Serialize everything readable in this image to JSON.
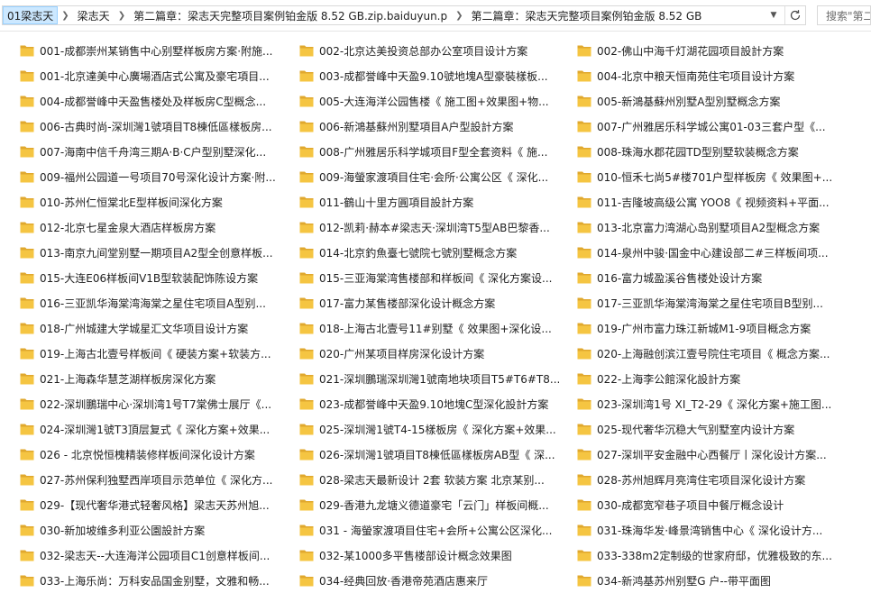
{
  "breadcrumbs": [
    "01梁志天",
    "梁志天",
    "第二篇章：梁志天完整项目案例铂金版  8.52 GB.zip.baiduyun.p",
    "第二篇章：梁志天完整项目案例铂金版  8.52 GB"
  ],
  "search": {
    "placeholder": "搜索\"第二"
  },
  "icons": {
    "folder": "folder-icon",
    "refresh": "refresh-icon",
    "dropdown": "chevron-down-icon",
    "separator": "chevron-right-icon"
  },
  "colors": {
    "folder": "#f5c542",
    "folder_dark": "#e0a82e",
    "selection": "#cce8ff"
  },
  "items": [
    "001-成都崇州某销售中心别墅样板房方案·附施...",
    "002-北京达美投资总部办公室项目设计方案",
    "002-佛山中海千灯湖花园项目設計方案",
    "001-北京達美中心廣場酒店式公寓及豪宅項目...",
    "003-成都誉峰中天盈9.10號地塊A型豪裝樣板...",
    "004-北京中粮天恒南苑住宅项目设计方案",
    "004-成都誉峰中天盈售楼处及样板房C型概念...",
    "005-大连海洋公园售楼《 施工图+效果图+物...",
    "005-新鴻基蘇州別墅A型別墅概念方案",
    "006-古典时尚-深圳灣1號項目T8棟低區樣板房...",
    "006-新鴻基蘇州別墅項目A户型設計方案",
    "007-广州雅居乐科学城公寓01-03三套户型《...",
    "007-海南中信千舟湾三期A·B·C户型别墅深化...",
    "008-广州雅居乐科学城项目F型全套资料《 施...",
    "008-珠海水郡花园TD型别墅软装概念方案",
    "009-福州公园道一号项目70号深化设计方案·附...",
    "009-海螢家渡項目住宅·会所·公寓公区《 深化...",
    "010-恒禾七尚5#楼701户型样板房《 效果图+...",
    "010-苏州仁恒棠北E型样板间深化方案",
    "011-鶴山十里方圓項目設計方案",
    "011-吉隆坡高级公寓 YOO8《 视频资料+平面...",
    "012-北京七星金泉大酒店样板房方案",
    "012-凯莉·赫本#梁志天·深圳湾T5型AB巴黎香...",
    "013-北京富力湾湖心岛别墅项目A2型概念方案",
    "013-南京九间堂别墅一期项目A2型全创意样板...",
    "014-北京釣魚臺七號院七號別墅概念方案",
    "014-泉州中骏·国金中心建设部二#三样板间项...",
    "015-大连E06样板间V1B型软装配饰陈设方案",
    "015-三亚海棠湾售楼部和样板间《 深化方案设...",
    "016-富力城盈溪谷售楼处设计方案",
    "016-三亚凯华海棠湾海棠之星住宅项目A型别...",
    "017-富力某售楼部深化设计概念方案",
    "017-三亚凯华海棠湾海棠之星住宅项目B型别...",
    "018-广州城建大学城星汇文华项目设计方案",
    "018-上海古北壹号11#别墅《 效果图+深化设...",
    "019-广州市富力珠江新城M1-9项目概念方案",
    "019-上海古北壹号样板间《 硬装方案+软装方...",
    "020-广州某项目样房深化设计方案",
    "020-上海融创滨江壹号院住宅项目《 概念方案...",
    "021-上海森华慧芝湖样板房深化方案",
    "021-深圳鵬瑞深圳灣1號南地块项目T5#T6#T8...",
    "022-上海李公館深化設計方案",
    "022-深圳鵬瑞中心·深圳湾1号T7棠佛士展厅《...",
    "023-成都誉峰中天盈9.10地塊C型深化設計方案",
    "023-深圳湾1号 XI_T2-29《 深化方案+施工图...",
    "024-深圳灣1號T3頂层复式《 深化方案+效果...",
    "025-深圳灣1號T4-15樣板房《 深化方案+效果...",
    "025-现代奢华沉稳大气别墅室内设计方案",
    "026 - 北京悦恒槐精装修样板间深化设计方案",
    "026-深圳灣1號項目T8棟低區樣板房AB型《 深...",
    "027-深圳平安金融中心西餐厅丨深化设计方案...",
    "027-苏州保利独墅西岸项目示范单位《 深化方...",
    "028-梁志天最新设计 2套 软装方案 北京某别...",
    "028-苏州旭辉月亮湾住宅项目深化设计方案",
    "029-【现代奢华港式轻奢风格】梁志天苏州旭...",
    "029-香港九龙塘义德道豪宅「云门」样板间概...",
    "030-成都宽窄巷子项目中餐厅概念设计",
    "030-新加坡维多利亚公園設計方案",
    "031 - 海螢家渡項目住宅+会所+公寓公区深化...",
    "031-珠海华发·峰景湾销售中心《 深化设计方...",
    "032-梁志天--大连海洋公园项目C1创意样板间...",
    "032-某1000多平售楼部设计概念效果图",
    "033-338m2定制级的世家府邸，优雅极致的东...",
    "033-上海乐尚：万科安品国金别墅，文雅和畅...",
    "034-经典回放·香港帝苑酒店惠来厅",
    "034-新鸿基苏州别墅G 户--带平面图"
  ]
}
